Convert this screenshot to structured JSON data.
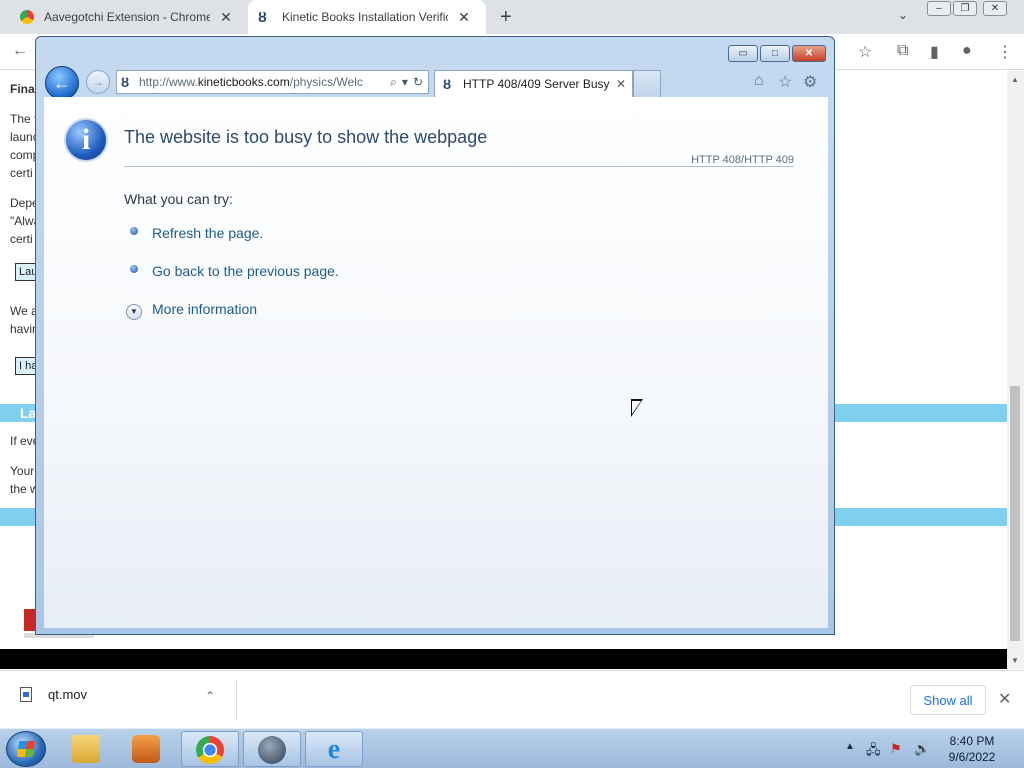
{
  "chrome": {
    "tabs": [
      {
        "title": "Aavegotchi Extension - Chrome W",
        "close": "✕"
      },
      {
        "title": "Kinetic Books Installation Verifica",
        "close": "✕"
      }
    ],
    "new_tab": "+",
    "tab_menu": "⌄",
    "toolbar": {
      "back": "←",
      "star": "☆",
      "extensions": "⧉",
      "sidepanel": "▮",
      "profile": "●",
      "menu": "⋮"
    }
  },
  "background_page": {
    "lines": [
      "Fina",
      "The f",
      "launc",
      "comp",
      "certi",
      "Depe",
      "\"Alwa",
      "certi",
      "We a",
      "havin",
      "If eve",
      "Your",
      "the w"
    ],
    "buttons": [
      "Lau",
      "I ha"
    ],
    "section_heading": "La"
  },
  "ie": {
    "window_buttons": {
      "minimize": "▭",
      "maximize": "□",
      "close": "✕"
    },
    "back": "←",
    "forward": "→",
    "address": {
      "prefix": "http://www.",
      "domain": "kineticbooks.com",
      "path": "/physics/Welc"
    },
    "tab": {
      "title": "HTTP 408/409 Server Busy",
      "close": "✕"
    },
    "tools": {
      "home": "⌂",
      "favorites": "☆",
      "settings": "⚙"
    },
    "error": {
      "title": "The website is too busy to show the webpage",
      "code": "HTTP 408/HTTP 409",
      "try_label": "What you can try:",
      "links": [
        "Refresh the page.",
        "Go back to the previous page."
      ],
      "more_info": "More information"
    }
  },
  "downloads": {
    "file": "qt.mov",
    "chevron": "⌃",
    "show_all": "Show all",
    "close": "✕"
  },
  "taskbar": {
    "clock_time": "8:40 PM",
    "clock_date": "9/6/2022",
    "tray_arrow": "▲"
  }
}
